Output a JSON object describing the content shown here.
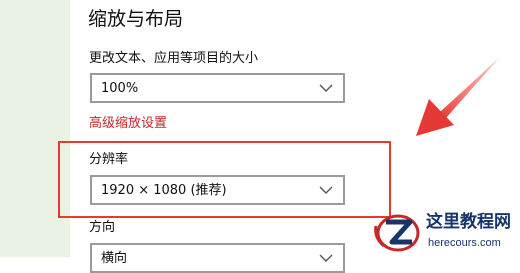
{
  "section": {
    "title": "缩放与布局"
  },
  "scale": {
    "label": "更改文本、应用等项目的大小",
    "value": "100%"
  },
  "advanced_scaling_link": "高级缩放设置",
  "resolution": {
    "label": "分辨率",
    "value": "1920 × 1080 (推荐)"
  },
  "orientation": {
    "label": "方向",
    "value": "横向"
  },
  "watermark": {
    "title": "这里教程网",
    "url": "herecours.com"
  },
  "colors": {
    "link": "#c1272d",
    "highlight": "#e53935",
    "watermark": "#17356b"
  }
}
